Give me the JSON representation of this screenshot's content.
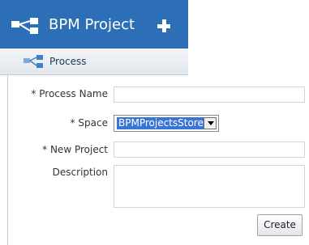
{
  "header": {
    "title": "BPM Project",
    "add_icon": "plus-icon",
    "logo_icon": "process-flow-icon"
  },
  "tab": {
    "label": "Process",
    "icon": "process-flow-icon"
  },
  "form": {
    "required_mark": "*",
    "process_name": {
      "label": "Process Name",
      "value": ""
    },
    "space": {
      "label": "Space",
      "selected": "BPMProjectsStore"
    },
    "new_project": {
      "label": "New Project",
      "value": ""
    },
    "description": {
      "label": "Description",
      "value": ""
    },
    "create_label": "Create"
  },
  "colors": {
    "header_bg": "#2c6fb7",
    "selection": "#3875d7"
  }
}
